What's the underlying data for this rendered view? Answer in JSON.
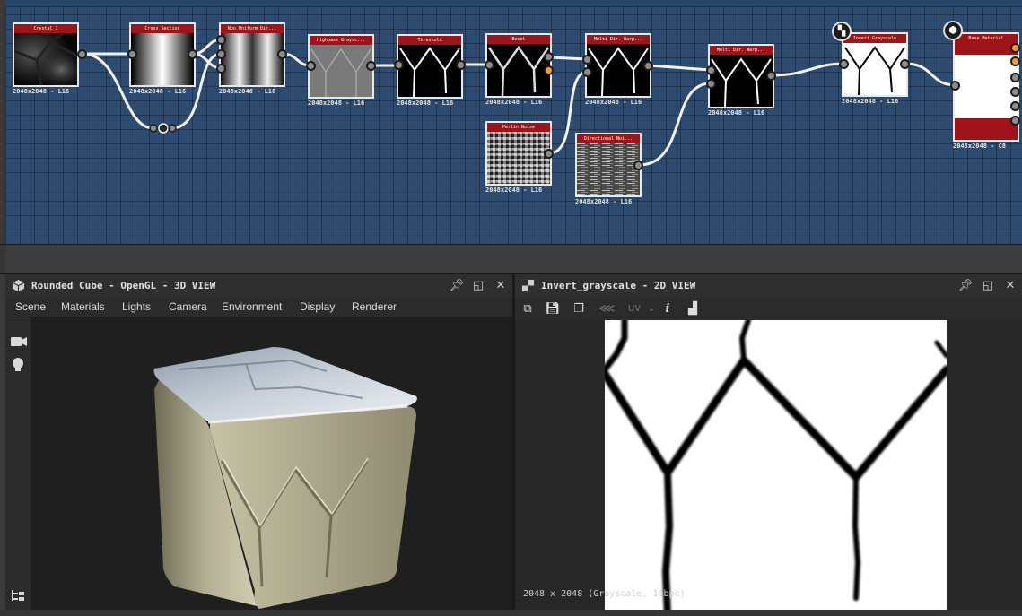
{
  "graph": {
    "nodes": [
      {
        "id": "crystal",
        "title": "Crystal 1",
        "res": "2048x2048 - L16"
      },
      {
        "id": "cross",
        "title": "Cross Section",
        "res": "2048x2048 - L16"
      },
      {
        "id": "nonuniform",
        "title": "Non Uniform Dir...",
        "res": "2048x2048 - L16"
      },
      {
        "id": "highpass",
        "title": "Highpass Graysc...",
        "res": "2048x2048 - L16"
      },
      {
        "id": "threshold",
        "title": "Threshold",
        "res": "2048x2048 - L16"
      },
      {
        "id": "bevel",
        "title": "Bevel",
        "res": "2048x2048 - L16"
      },
      {
        "id": "multidir1",
        "title": "Multi Dir. Warp...",
        "res": "2048x2048 - L16"
      },
      {
        "id": "perlin",
        "title": "Perlin Noise",
        "res": "2048x2048 - L16"
      },
      {
        "id": "directional",
        "title": "Directional Noi...",
        "res": "2048x2048 - L16"
      },
      {
        "id": "multidir2",
        "title": "Multi Dir. Warp...",
        "res": "2048x2048 - L16"
      },
      {
        "id": "invert",
        "title": "Invert Grayscale",
        "res": "2048x2048 - L16"
      },
      {
        "id": "basematerial",
        "title": "Base Material",
        "res": "2048x2048 - C8"
      }
    ]
  },
  "panel3d": {
    "title": "Rounded Cube - OpenGL - 3D VIEW",
    "menu": [
      "Scene",
      "Materials",
      "Lights",
      "Camera",
      "Environment",
      "Display",
      "Renderer"
    ],
    "icons": [
      "cube-icon",
      "pin-icon",
      "maximize-icon",
      "close-icon",
      "camera-icon",
      "light-icon",
      "outliner-icon"
    ]
  },
  "panel2d": {
    "title": "Invert_grayscale - 2D VIEW",
    "toolbar": [
      "frame-icon",
      "save-icon",
      "copy-icon",
      "share-icon",
      "UV",
      "info-icon",
      "histogram-icon"
    ],
    "uv_label": "UV",
    "status": "2048 x 2048 (Grayscale, 16bpc)"
  },
  "colors": {
    "graph_bg": "#2d4b70",
    "node_header": "#9e1418",
    "orange_port": "#f0a020"
  }
}
